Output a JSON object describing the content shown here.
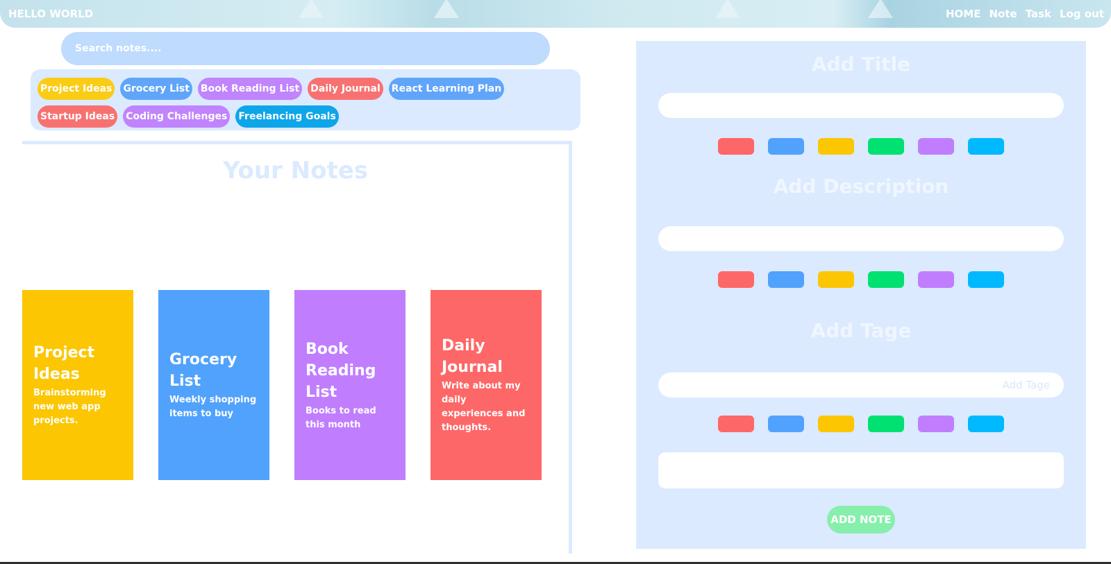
{
  "header": {
    "brand": "HELLO WORLD",
    "nav": [
      "HOME",
      "Note",
      "Task",
      "Log out"
    ]
  },
  "search": {
    "placeholder": "Search notes...."
  },
  "tags": [
    {
      "label": "Project Ideas",
      "color": "#facc15"
    },
    {
      "label": "Grocery List",
      "color": "#60a5fa"
    },
    {
      "label": "Book Reading List",
      "color": "#c084fc"
    },
    {
      "label": "Daily Journal",
      "color": "#f87171"
    },
    {
      "label": "React Learning Plan",
      "color": "#60a5fa"
    },
    {
      "label": "Startup Ideas",
      "color": "#f87171"
    },
    {
      "label": "Coding Challenges",
      "color": "#c084fc"
    },
    {
      "label": "Freelancing Goals",
      "color": "#0ea5e9"
    }
  ],
  "notes_section": {
    "title": "Your Notes",
    "cards": [
      {
        "title": "Project Ideas",
        "description": "Brainstorming new web app projects.",
        "color": "#fcc602"
      },
      {
        "title": "Grocery List",
        "description": "Weekly shopping items to buy",
        "color": "#51a2fc"
      },
      {
        "title": "Book Reading List",
        "description": "Books to read this month",
        "color": "#c07eff"
      },
      {
        "title": "Daily Journal",
        "description": "Write about my daily experiences and thoughts.",
        "color": "#fe6767"
      }
    ]
  },
  "form": {
    "title_heading": "Add Title",
    "description_heading": "Add Description",
    "tag_heading": "Add Tage",
    "tag_placeholder": "Add Tage",
    "swatch_colors": [
      "#fe6767",
      "#51a2fc",
      "#fcc602",
      "#00e171",
      "#c07eff",
      "#00b9ff"
    ],
    "submit_label": "ADD NOTE"
  }
}
